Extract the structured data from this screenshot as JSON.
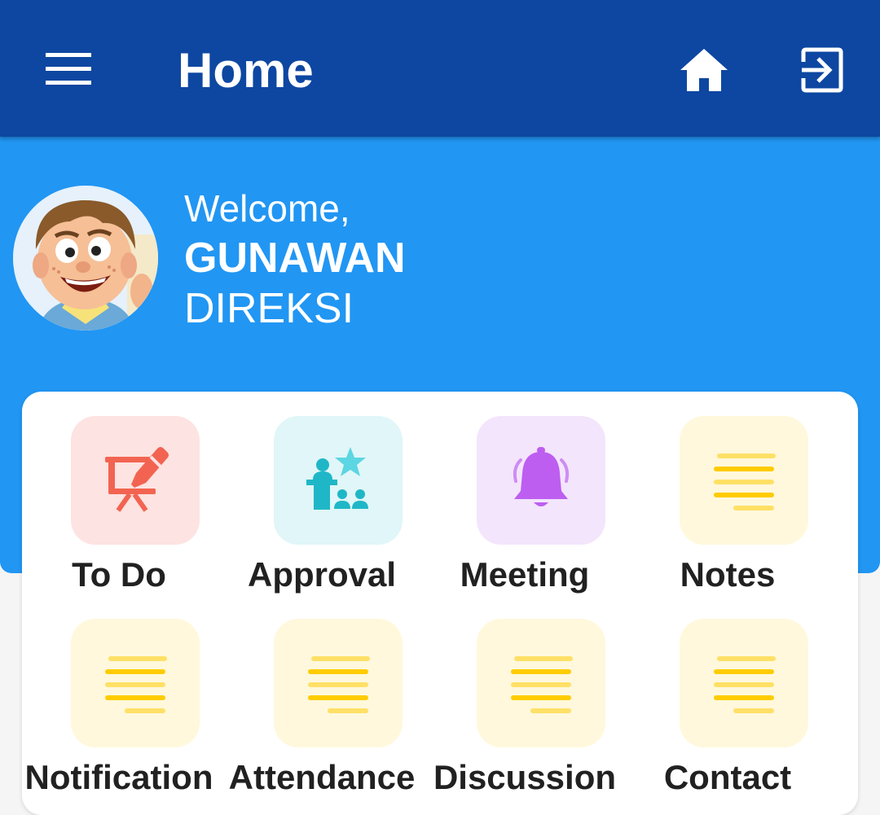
{
  "appbar": {
    "title": "Home",
    "menu_icon": "hamburger-menu-icon",
    "home_icon": "home-icon",
    "logout_icon": "logout-icon"
  },
  "profile": {
    "welcome": "Welcome,",
    "name": "GUNAWAN",
    "role": "DIREKSI"
  },
  "colors": {
    "appbar": "#0d47a1",
    "hero": "#2196f3",
    "card": "#ffffff"
  },
  "menu": {
    "items": [
      {
        "label": "To Do",
        "icon": "presentation-board-icon",
        "bg": "#fde3e1"
      },
      {
        "label": "Approval",
        "icon": "award-podium-icon",
        "bg": "#e0f6f8"
      },
      {
        "label": "Meeting",
        "icon": "bell-icon",
        "bg": "#f3e5fc"
      },
      {
        "label": "Notes",
        "icon": "notes-lines-icon",
        "bg": "#fff8dc"
      },
      {
        "label": "Notification",
        "icon": "notes-lines-icon",
        "bg": "#fff8dc"
      },
      {
        "label": "Attendance",
        "icon": "notes-lines-icon",
        "bg": "#fff8dc"
      },
      {
        "label": "Discussion",
        "icon": "notes-lines-icon",
        "bg": "#fff8dc"
      },
      {
        "label": "Contact",
        "icon": "notes-lines-icon",
        "bg": "#fff8dc"
      }
    ]
  }
}
